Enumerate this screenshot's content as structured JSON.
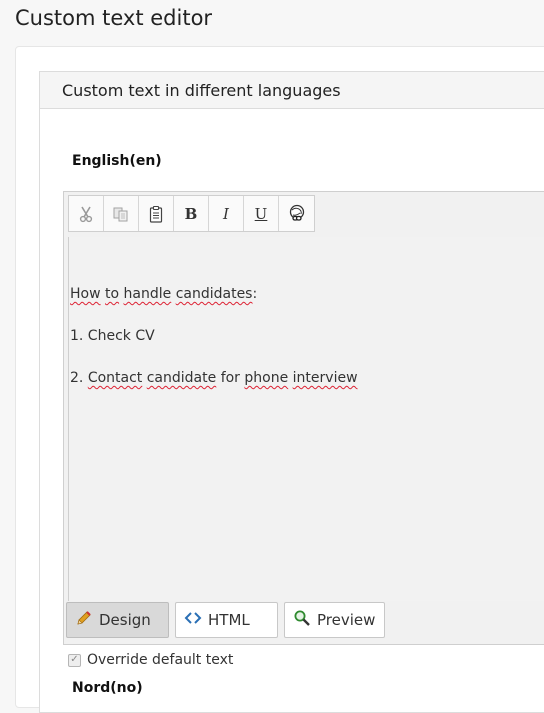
{
  "page": {
    "title": "Custom text editor"
  },
  "panel": {
    "title": "Custom text in different languages"
  },
  "language": {
    "label": "English(en)",
    "next_label": "Nord(no)"
  },
  "toolbar": {
    "buttons": [
      {
        "name": "cut",
        "icon": "scissors-icon"
      },
      {
        "name": "copy",
        "icon": "copy-icon"
      },
      {
        "name": "paste",
        "icon": "clipboard-icon"
      },
      {
        "name": "bold",
        "glyph": "B"
      },
      {
        "name": "italic",
        "glyph": "I"
      },
      {
        "name": "underline",
        "glyph": "U"
      },
      {
        "name": "link",
        "icon": "link-icon"
      }
    ]
  },
  "content": {
    "line1_words": [
      "How",
      "to",
      "handle",
      "candidates"
    ],
    "line1_suffix": ":",
    "line2": "1. Check CV",
    "line3_prefix": "2. ",
    "line3_words": [
      "Contact",
      "candidate",
      "for",
      "phone",
      "interview"
    ]
  },
  "modes": {
    "design": "Design",
    "html": "HTML",
    "preview": "Preview"
  },
  "override": {
    "label": "Override default text",
    "checked": true
  },
  "colors": {
    "spellcheck": "#dd2233",
    "pencil": "#e0a020",
    "html_icon": "#2a6fb5",
    "preview_icon": "#2f8a2f"
  }
}
